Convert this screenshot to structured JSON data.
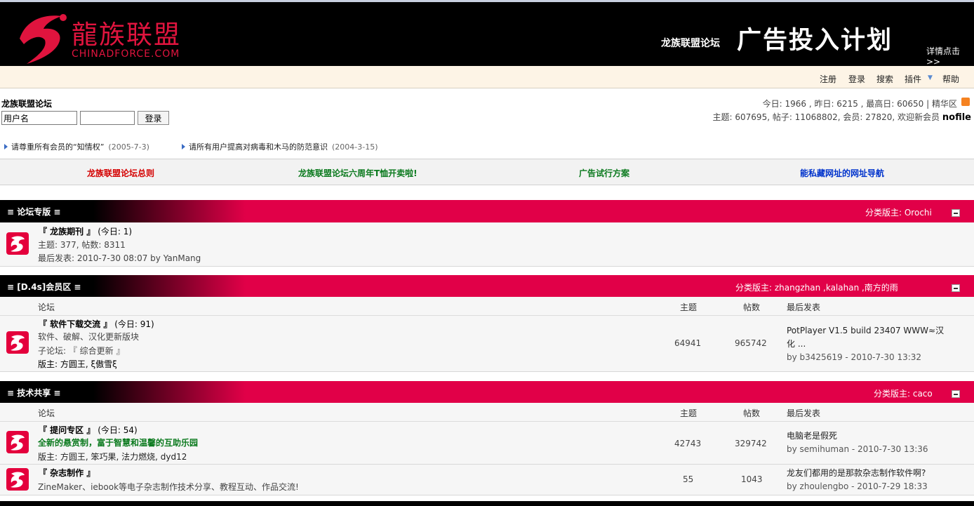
{
  "header": {
    "logo_cn": "龍族联盟",
    "logo_en": "CHINADFORCE.COM",
    "banner_small": "龙族联盟论坛",
    "banner_big": "广告投入计划",
    "banner_detail": "详情点击>>"
  },
  "menu": [
    "注册",
    "登录",
    "搜索",
    "插件",
    "帮助"
  ],
  "info": {
    "forum_name": "龙族联盟论坛",
    "username_placeholder": "用户名",
    "login_label": "登录",
    "stats_line1": "今日: 1966 , 昨日: 6215 , 最高日: 60650 | 精华区",
    "stats_line2": "主题: 607695, 帖子: 11068802, 会员: 27820, 欢迎新会员",
    "newest_member": "nofile"
  },
  "announcements": [
    {
      "text": "请尊重所有会员的“知情权”",
      "date": "(2005-7-3)"
    },
    {
      "text": "请所有用户提高对病毒和木马的防范意识",
      "date": "(2004-3-15)"
    }
  ],
  "links": [
    {
      "text": "龙族联盟论坛总则",
      "color": "#d40000"
    },
    {
      "text": "龙族联盟论坛六周年T恤开卖啦!",
      "color": "#0b7a1e"
    },
    {
      "text": "广告试行方案",
      "color": "#0b7a1e"
    },
    {
      "text": "能私藏网址的网址导航",
      "color": "#0033cc"
    }
  ],
  "sections": [
    {
      "title": "≡ 论坛专版 ≡",
      "mods": "分类版主: Orochi",
      "forums": [
        {
          "name": "『 龙族期刊 』",
          "today": "(今日: 1)",
          "stats": "主题: 377, 帖数: 8311",
          "last": "最后发表: 2010-7-30 08:07 by YanMang"
        }
      ]
    },
    {
      "title": "≡ [D.4s]会员区 ≡",
      "mods": "分类版主: zhangzhan ,kalahan ,南方的雨",
      "columns": [
        "论坛",
        "主题",
        "帖数",
        "最后发表"
      ],
      "forums": [
        {
          "name": "『 软件下载交流 』",
          "today": "(今日: 91)",
          "desc": "软件、破解、汉化更新版块",
          "sub": "子论坛: 『 综合更新 』",
          "moderators": "版主: 方圆王, ξ傲雪ξ",
          "threads": "64941",
          "posts": "965742",
          "last_title_1": "PotPlayer V1.5 build 23407 WWW≈汉",
          "last_title_2": "化 ...",
          "last_by": "by b3425619 - 2010-7-30 13:32"
        }
      ]
    },
    {
      "title": "≡ 技术共享 ≡",
      "mods": "分类版主: caco",
      "columns": [
        "论坛",
        "主题",
        "帖数",
        "最后发表"
      ],
      "forums": [
        {
          "name": "『 提问专区 』",
          "today": "(今日: 54)",
          "desc": "全新的悬赏制，富于智慧和温馨的互助乐园",
          "moderators": "版主: 方圆王, 笨巧果, 法力燃烧, dyd12",
          "threads": "42743",
          "posts": "329742",
          "last_title": "电脑老是假死",
          "last_by": "by semihuman - 2010-7-30 13:36"
        },
        {
          "name": "『 杂志制作 』",
          "desc": "ZineMaker、iebook等电子杂志制作技术分享、教程互动、作品交流!",
          "threads": "55",
          "posts": "1043",
          "last_title": "龙友们都用的是那款杂志制作软件啊?",
          "last_by": "by zhoulengbo - 2010-7-29 18:33"
        }
      ]
    }
  ]
}
